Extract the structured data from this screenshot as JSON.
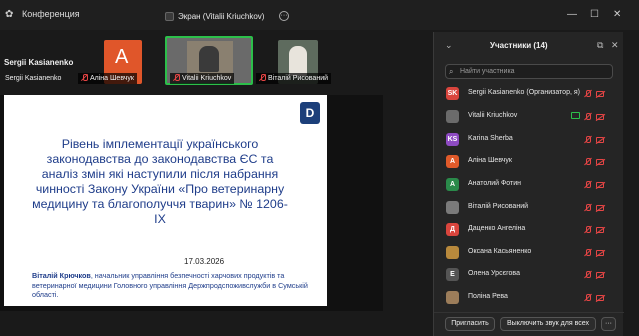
{
  "window": {
    "app_title": "Конференция",
    "tab_title": "Экран (Vitalii Kriuchkov)"
  },
  "gallery": {
    "host": "Sergii Kasianenko",
    "tiles": [
      {
        "label": "Sergii Kasianenko",
        "muted": false
      },
      {
        "label": "Аліна Шевчук",
        "initial": "А",
        "muted": true
      },
      {
        "label": "Vitalii Kriuchkov",
        "muted": true,
        "active": true
      },
      {
        "label": "Віталій Рисований",
        "muted": true
      }
    ]
  },
  "slide": {
    "title": "Рівень імплементації українського законодавства до законодавства ЄС та аналіз змін які наступили після набрання чинності Закону України «Про ветеринарну медицину та благополуччя тварин» № 1206-IX",
    "date": "17.03.2026",
    "author_name": "Віталій Крючков",
    "author_rest": ", начальник управління безпечності харчових продуктів та ветеринарної медицини Головного управління Держпродспоживслужби в Сумській області.",
    "logo": "D"
  },
  "panel": {
    "title": "Участники (14)",
    "search_placeholder": "Найти участника",
    "participants": [
      {
        "name": "Sergii Kasianenko (Организатор, я)",
        "initial": "SK",
        "color": "#d9453d"
      },
      {
        "name": "Vitalii Kriuchkov",
        "initial": "",
        "color": "#6b6b6b",
        "sharing": true
      },
      {
        "name": "Karina Sherba",
        "initial": "KS",
        "color": "#8e4bc2"
      },
      {
        "name": "Аліна Шевчук",
        "initial": "А",
        "color": "#e05a2a"
      },
      {
        "name": "Анатолий Фотин",
        "initial": "А",
        "color": "#2a8a4a"
      },
      {
        "name": "Віталій Рисований",
        "initial": "",
        "color": "#7a7a7a"
      },
      {
        "name": "Даценко Ангеліна",
        "initial": "Д",
        "color": "#d9453d"
      },
      {
        "name": "Оксана Касьяненко",
        "initial": "",
        "color": "#b8893c"
      },
      {
        "name": "Олена Урсєгова",
        "initial": "Е",
        "color": "#555"
      },
      {
        "name": "Поліна Рева",
        "initial": "",
        "color": "#9c7d5a"
      }
    ],
    "invite_label": "Пригласить",
    "mute_all_label": "Выключить звук для всех",
    "more_label": "···"
  }
}
